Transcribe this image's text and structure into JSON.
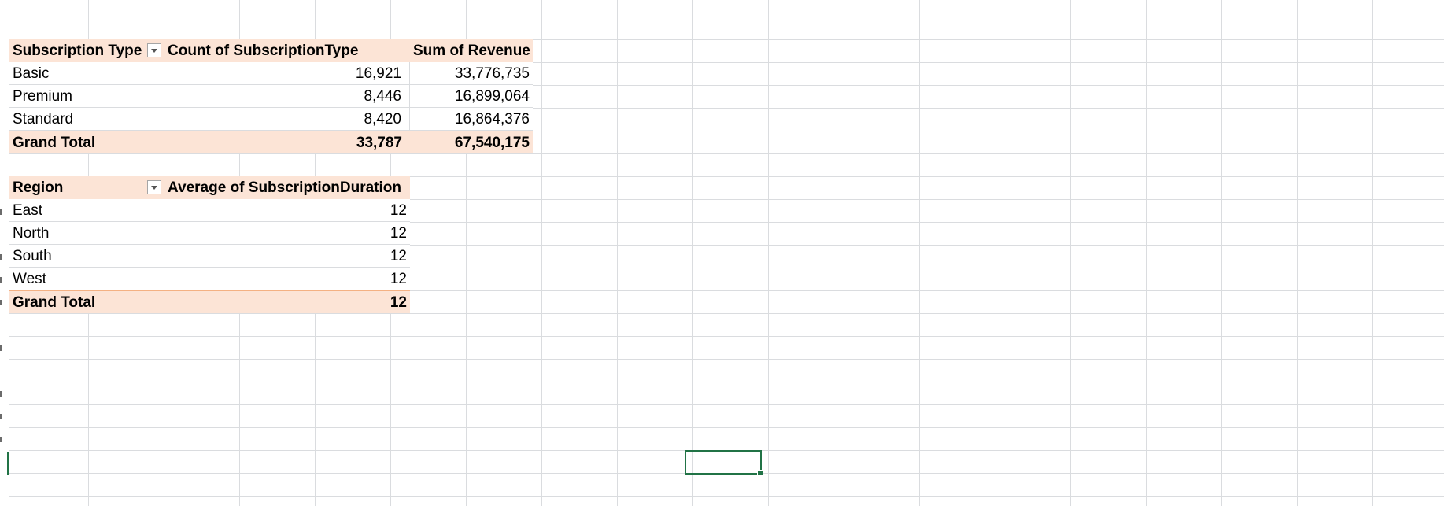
{
  "pivot1": {
    "headers": [
      "Subscription Type",
      "Count of SubscriptionType",
      "Sum of Revenue"
    ],
    "rows": [
      [
        "Basic",
        "16,921",
        "33,776,735"
      ],
      [
        "Premium",
        "8,446",
        "16,899,064"
      ],
      [
        "Standard",
        "8,420",
        "16,864,376"
      ]
    ],
    "total": [
      "Grand Total",
      "33,787",
      "67,540,175"
    ]
  },
  "pivot2": {
    "headers": [
      "Region",
      "Average of SubscriptionDuration"
    ],
    "rows": [
      [
        "East",
        "12"
      ],
      [
        "North",
        "12"
      ],
      [
        "South",
        "12"
      ],
      [
        "West",
        "12"
      ]
    ],
    "total": [
      "Grand Total",
      "12"
    ]
  },
  "colors": {
    "pivot_header_fill": "#fce4d6",
    "pivot_total_border": "#f4b183",
    "gridline": "#dadcdf",
    "selection": "#217346"
  },
  "icons": {
    "filter_dropdown": "chevron-down-icon"
  }
}
